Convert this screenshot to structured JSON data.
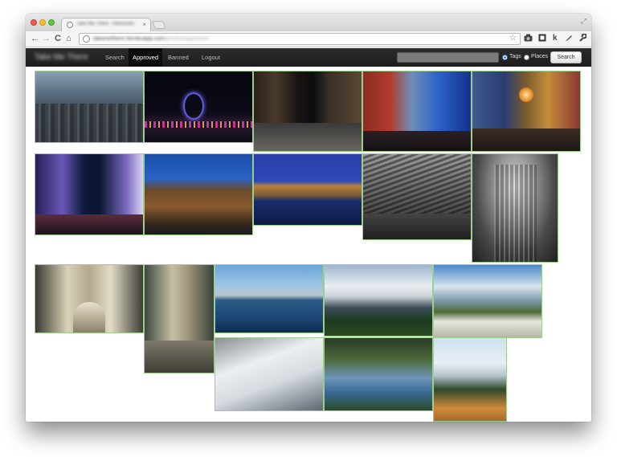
{
  "browser": {
    "tab_title": "Take Me There - Administration",
    "tab_close": "×",
    "url_domain": "takemethere.herokuapp.com",
    "url_path": "/photos/approved",
    "buttons": {
      "back": "←",
      "forward": "→",
      "reload": "C",
      "home": "⌂",
      "bookmark": "☆",
      "fullscreen": "⤢"
    },
    "extensions": [
      "k"
    ]
  },
  "app": {
    "brand": "Take Me There",
    "nav": [
      {
        "label": "Search",
        "active": false
      },
      {
        "label": "Approved",
        "active": true
      },
      {
        "label": "Banned",
        "active": false
      },
      {
        "label": "Logout",
        "active": false
      }
    ],
    "search": {
      "placeholder": "",
      "options": [
        {
          "label": "Tags",
          "checked": true
        },
        {
          "label": "Places",
          "checked": false
        }
      ],
      "button_label": "Search"
    }
  },
  "gallery": {
    "photos": [
      {
        "name": "london-city-skyline",
        "border": "#9ccf8e"
      },
      {
        "name": "london-eye-night",
        "border": "#9ccf8e"
      },
      {
        "name": "street-night",
        "border": "#9ccf8e"
      },
      {
        "name": "red-building-dusk",
        "border": "#9ccf8e"
      },
      {
        "name": "chinatown-lanterns",
        "border": "#9ccf8e"
      },
      {
        "name": "piccadilly-night",
        "border": "#9ccf8e"
      },
      {
        "name": "harrods-building",
        "border": "#9ccf8e"
      },
      {
        "name": "houses-of-parliament",
        "border": "#9ccf8e"
      },
      {
        "name": "station-roof-bw",
        "border": "#9ccf8e"
      },
      {
        "name": "arcade-bw",
        "border": "#9ccf8e"
      },
      {
        "name": "st-pauls-view-1",
        "border": "#9ccf8e"
      },
      {
        "name": "st-pauls-view-2",
        "border": "#9ccf8e"
      },
      {
        "name": "city-waterfront",
        "border": "#9ccf8e"
      },
      {
        "name": "mountain-snow",
        "border": "#9ccf8e"
      },
      {
        "name": "mountain-valley",
        "border": "#9ccf8e"
      },
      {
        "name": "bobsleigh-track",
        "border": "#9ccf8e"
      },
      {
        "name": "lake-boat",
        "border": "#9ccf8e"
      },
      {
        "name": "alpine-meadow",
        "border": "#9ccf8e"
      }
    ]
  },
  "colors": {
    "navbar": "#1d1d1d",
    "active_link": "#0d0d0d",
    "photo_border": "#9ccf8e"
  }
}
